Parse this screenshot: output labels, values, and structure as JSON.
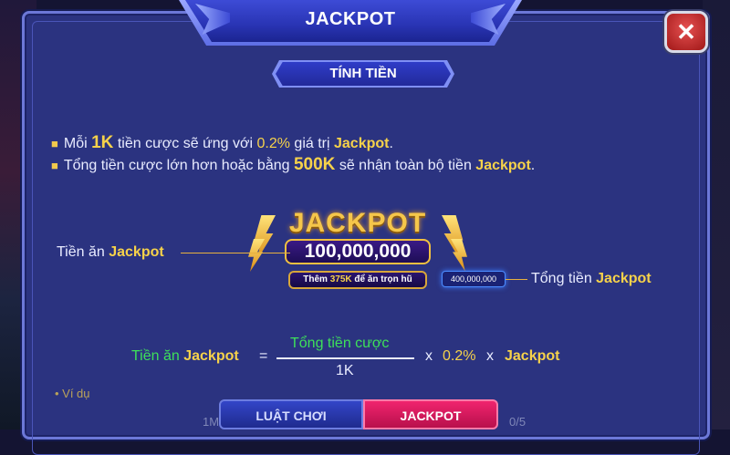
{
  "header": {
    "title": "JACKPOT",
    "subtitle": "TÍNH TIỀN",
    "close_glyph": "✕"
  },
  "rules": [
    {
      "p1": "Mỗi ",
      "v1": "1K",
      "p2": " tiền cược sẽ ứng với ",
      "v2": "0.2%",
      "p3": " giá trị ",
      "v3": "Jackpot",
      "p4": "."
    },
    {
      "p1": "Tổng tiền cược lớn hơn hoặc bằng ",
      "v1": "500K",
      "p2": " sẽ nhận toàn bộ tiền ",
      "v2": "Jackpot",
      "p3": "."
    }
  ],
  "illustration": {
    "logo_text": "JACKPOT",
    "value": "100,000,000",
    "extra_prefix": "Thêm ",
    "extra_amount": "375K",
    "extra_suffix": " để ăn trọn hũ",
    "total": "400,000,000",
    "left_label_text": "Tiền ăn ",
    "left_label_bold": "Jackpot",
    "right_label_text": "Tổng tiền ",
    "right_label_bold": "Jackpot"
  },
  "formula": {
    "lhs_text": "Tiền ăn ",
    "lhs_bold": "Jackpot",
    "equals": "=",
    "numerator": "Tổng tiền cược",
    "denominator": "1K",
    "times1": "x",
    "percent": "0.2%",
    "times2": "x",
    "jackpot": "Jackpot"
  },
  "example_label": "• Ví dụ",
  "tabs": [
    {
      "label": "LUẬT CHƠI",
      "active": false
    },
    {
      "label": "JACKPOT",
      "active": true
    }
  ],
  "footer": {
    "left": "1M",
    "right": "0/5"
  },
  "colors": {
    "panel": "#2b3380",
    "accent_gold": "#f6d24a",
    "formula_green": "#3ee05a",
    "active_tab": "#f0246e"
  }
}
